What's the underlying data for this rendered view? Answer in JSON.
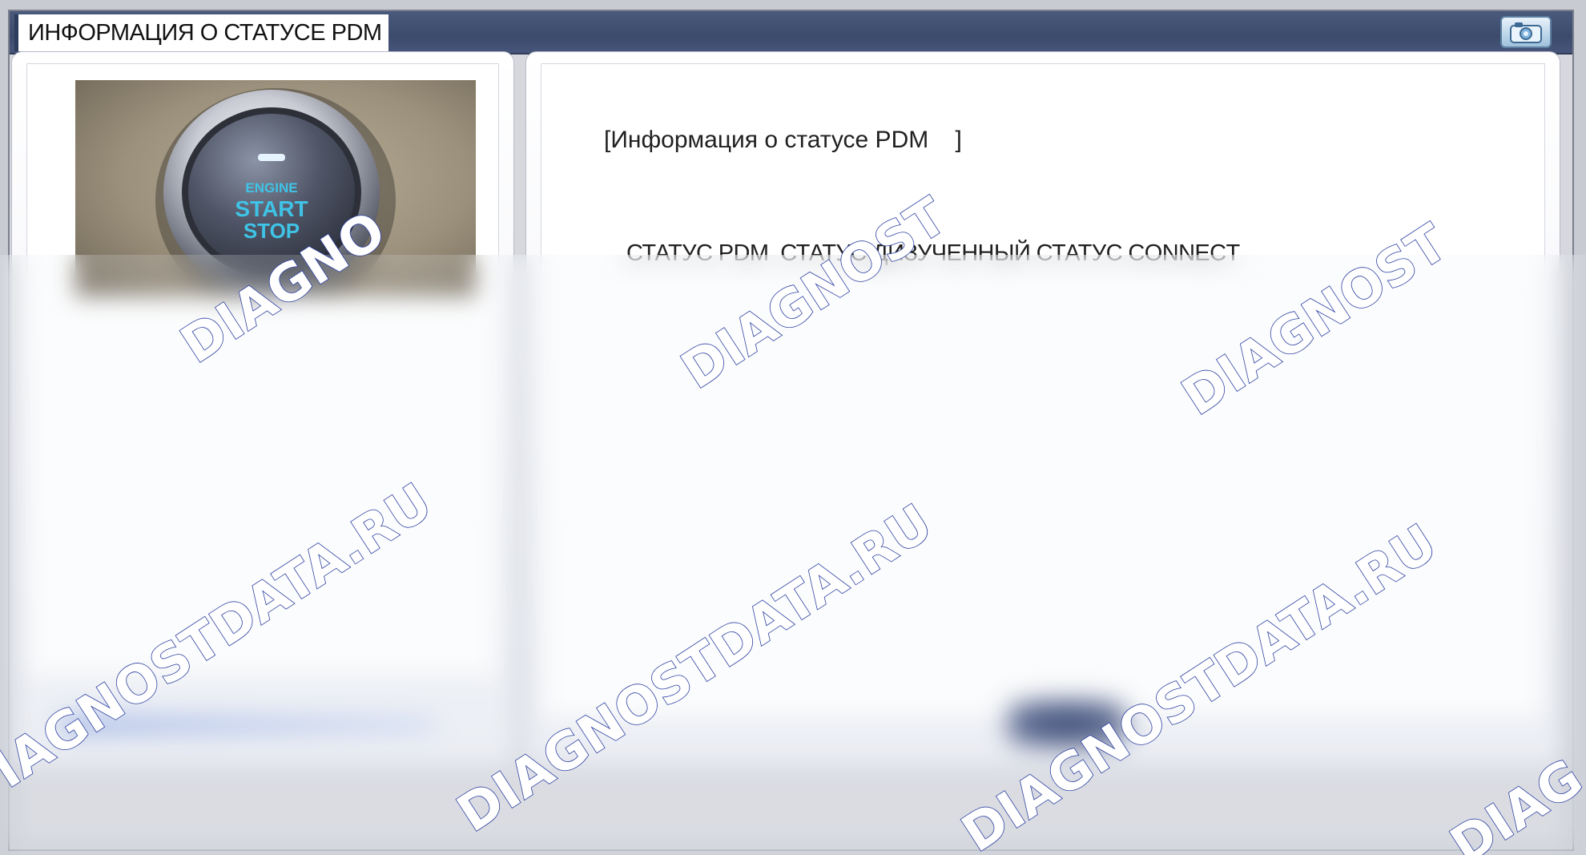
{
  "window": {
    "title": "ИНФОРМАЦИЯ О СТАТУСЕ PDM"
  },
  "toolbar": {
    "camera_icon": "camera-icon"
  },
  "left_panel": {
    "image_text": {
      "line1": "ENGINE",
      "line2": "START",
      "line3": "STOP"
    }
  },
  "main": {
    "section_header": "[Информация о статусе PDM    ]",
    "column_headers": "СТАТУС PDM  СТАТУС ДИЗУЧЕННЫЙ СТАТУС CONNECT"
  },
  "watermarks": {
    "short": "DIAGNOST",
    "short_cut": "DIAGNO",
    "long": "DIAGNOSTDATA.RU",
    "long_cut": "IAGNOSTDATA.RU",
    "tail": "DIAG"
  },
  "colors": {
    "titlebar": "#3c4b6c",
    "button_glow": "#3fc3e6",
    "watermark_outline": "#2c3fa0"
  }
}
